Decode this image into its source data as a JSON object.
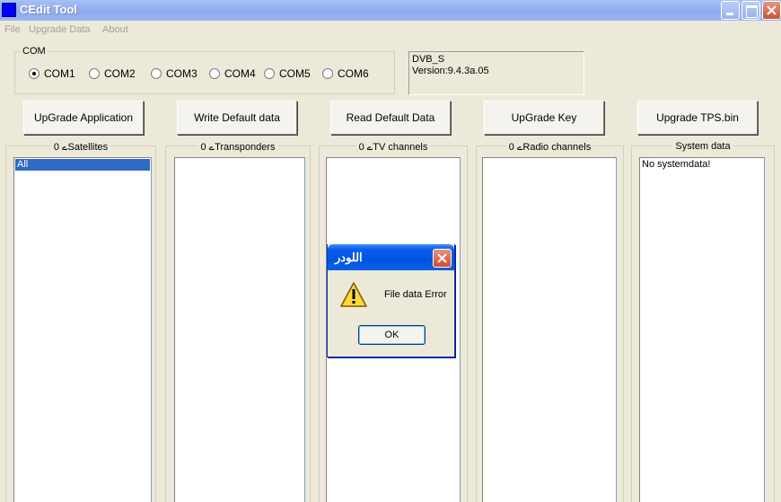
{
  "window": {
    "title": "CEdit Tool",
    "icon": "app-icon",
    "controls": [
      "minimize-icon",
      "maximize-icon",
      "close-icon"
    ]
  },
  "menu": {
    "items": [
      {
        "label": "File"
      },
      {
        "label": "Upgrade Data"
      },
      {
        "label": "About"
      }
    ]
  },
  "com_group": {
    "label": "COM",
    "options": [
      {
        "label": "COM1",
        "checked": true
      },
      {
        "label": "COM2",
        "checked": false
      },
      {
        "label": "COM3",
        "checked": false
      },
      {
        "label": "COM4",
        "checked": false
      },
      {
        "label": "COM5",
        "checked": false
      },
      {
        "label": "COM6",
        "checked": false
      }
    ]
  },
  "info": {
    "line1": "DVB_S",
    "line2": "Version:9.4.3a.05"
  },
  "buttons": {
    "upgrade_app": "UpGrade Application",
    "write_default": "Write Default data",
    "read_default": "Read Default Data",
    "upgrade_key": "UpGrade Key",
    "upgrade_tps": "Upgrade TPS.bin"
  },
  "panels": {
    "satellites": {
      "header": "0 ےSatellites",
      "items": [
        "All"
      ],
      "selected": "All"
    },
    "transponders": {
      "header": "0 ےTransponders",
      "items": []
    },
    "tv_channels": {
      "header": "0 ےTV channels",
      "items": []
    },
    "radio_channels": {
      "header": "0 ےRadio channels",
      "items": []
    },
    "system_data": {
      "header": "System data",
      "items": [
        "No systemdata!"
      ]
    }
  },
  "dialog": {
    "title": "اللودر",
    "message": "File data Error",
    "ok_label": "OK",
    "icon": "warning-icon"
  },
  "colors": {
    "title_bar": "#9db8f2",
    "dialog_title_bar": "#0054e3",
    "selection": "#316ac5",
    "window_bg": "#ece9d8"
  }
}
